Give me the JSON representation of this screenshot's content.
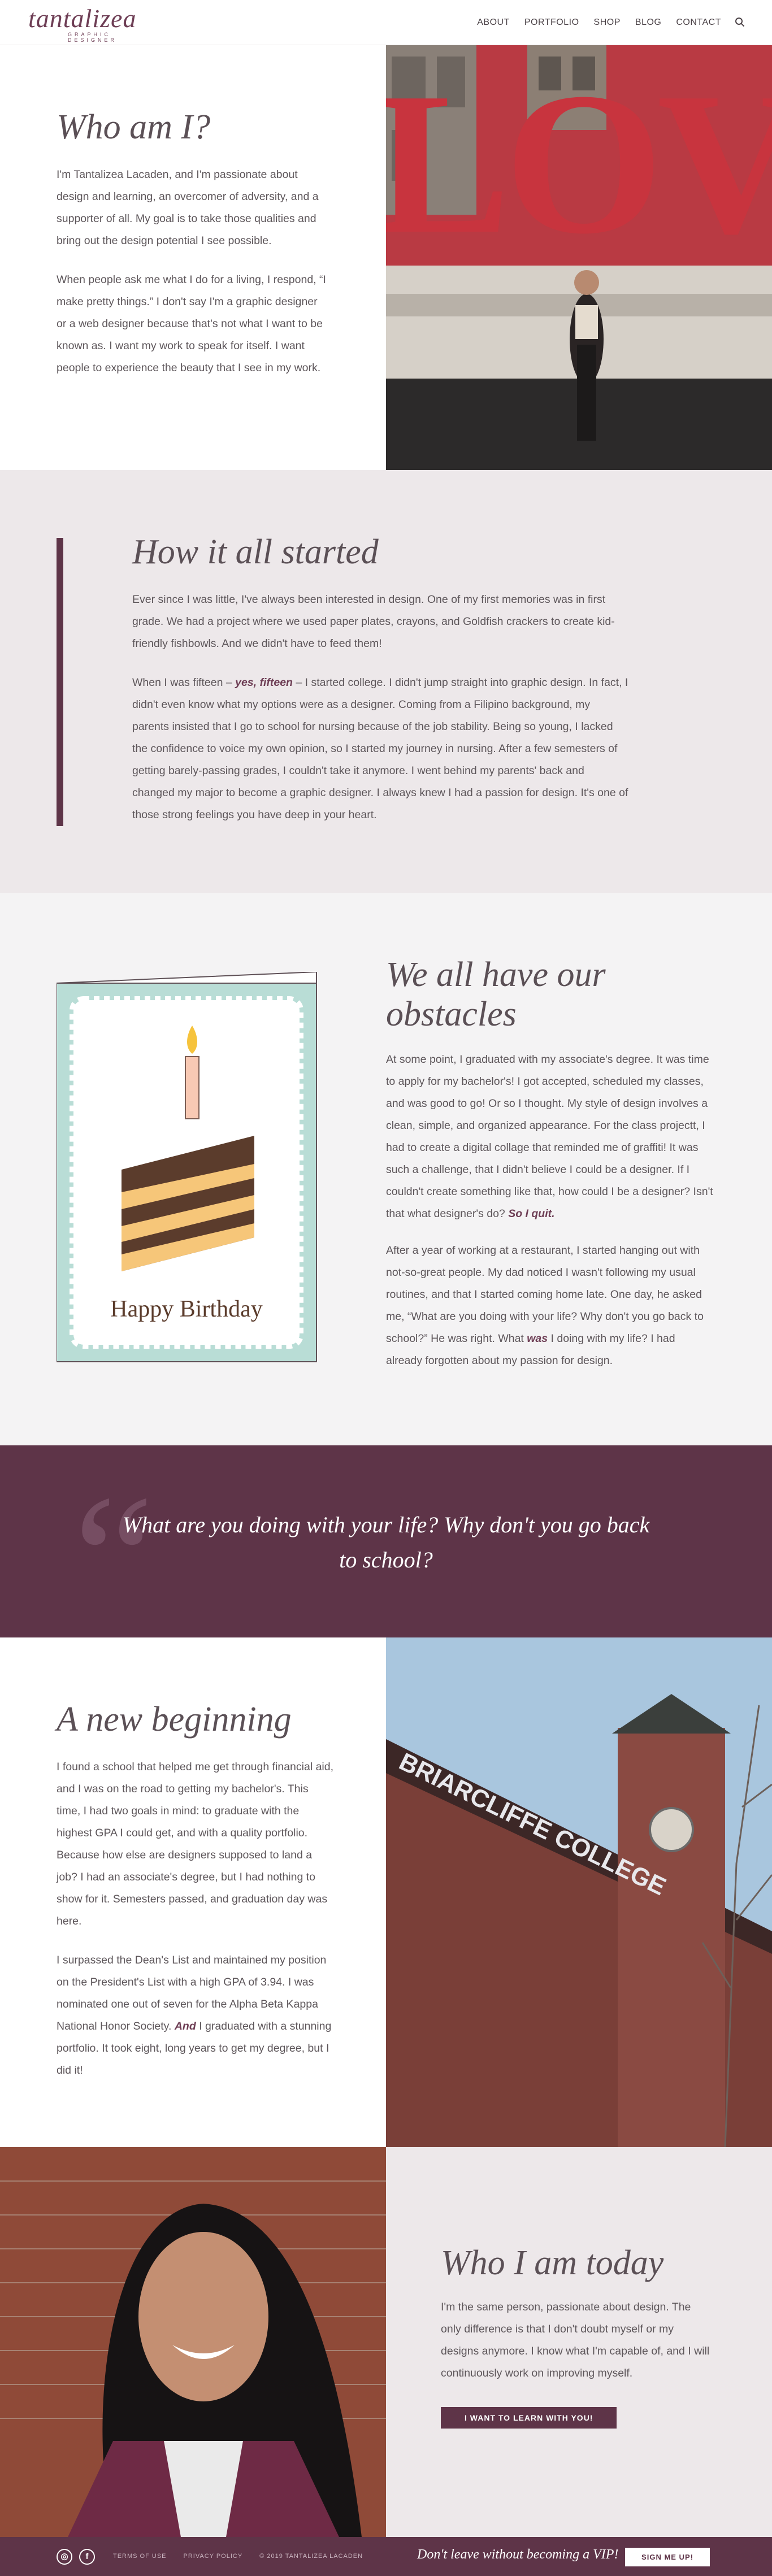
{
  "header": {
    "logo_main": "tantalizea",
    "logo_sub": "GRAPHIC DESIGNER",
    "nav": [
      "ABOUT",
      "PORTFOLIO",
      "SHOP",
      "BLOG",
      "CONTACT"
    ]
  },
  "who": {
    "title": "Who am I?",
    "p1": "I'm Tantalizea Lacaden, and I'm passionate about design and learning, an overcomer of adversity, and a supporter of all. My goal is to take those qualities and bring out the design potential I see possible.",
    "p2": "When people ask me what I do for a living, I respond, “I make pretty things.” I don't say I'm a graphic designer or a web designer because that's not what I want to be known as. I want my work to speak for itself. I want people to experience the beauty that I see in my work.",
    "photo_text": "LOVE"
  },
  "started": {
    "title": "How it all started",
    "p1": "Ever since I was little, I've always been interested in design. One of my first memories was in first grade. We had a project where we used paper plates, crayons, and Goldfish crackers to create kid-friendly fishbowls. And we didn't have to feed them!",
    "p2_a": "When I was fifteen – ",
    "p2_em": "yes, fifteen",
    "p2_b": " – I started college. I didn't jump straight into graphic design. In fact, I didn't even know what my options were as a designer. Coming from a Filipino background, my parents insisted that I go to school for nursing because of the job stability. Being so young, I lacked the confidence to voice my own opinion, so I started my journey in nursing. After a few semesters of getting barely-passing grades, I couldn't take it anymore. I went behind my parents' back and changed my major to become a graphic designer. I always knew I had a passion for design. It's one of those strong feelings you have deep in your heart."
  },
  "obstacles": {
    "title": "We all have our obstacles",
    "card_text": "Happy Birthday",
    "p1_a": "At some point, I graduated with my associate's degree. It was time to apply for my bachelor's! I got accepted, scheduled my classes, and was good to go! Or so I thought. My style of design involves a clean, simple, and organized appearance. For the class projectt, I had to create a digital collage that reminded me of graffiti! It was such a challenge, that I didn't believe I could be a designer. If I couldn't create something like that, how could I be a designer? Isn't that what designer's do? ",
    "p1_em": "So I quit.",
    "p2_a": "After a year of working at a restaurant, I started hanging out with not-so-great people. My dad noticed I wasn't following my usual routines, and that I started coming home late. One day, he asked me, “What are you doing with your life? Why don't you go back to school?” He was right. What ",
    "p2_em": "was",
    "p2_b": " I doing with my life? I had already forgotten about my passion for design."
  },
  "quote": {
    "mark": "“",
    "text": "What are you doing with your life? Why don't you go back to school?"
  },
  "beginning": {
    "title": "A new beginning",
    "p1": "I found a school that helped me get through financial aid, and I was on the road to getting my bachelor's. This time, I had two goals in mind: to graduate with the highest GPA I could get, and with a quality portfolio. Because how else are designers supposed to land a job? I had an associate's degree, but I had nothing to show for it. Semesters passed, and graduation day was here.",
    "p2_a": "I surpassed the Dean's List and maintained my position on the President's List with a high GPA of 3.94. I was nominated one out of seven for the Alpha Beta Kappa National Honor Society. ",
    "p2_em": "And",
    "p2_b": " I graduated with a stunning portfolio. It took eight, long years to get my degree, but I did it!",
    "sign": "BRIARCLIFFE COLLEGE"
  },
  "today": {
    "title": "Who I am today",
    "p1": "I'm the same person, passionate about design. The only difference is that I don't doubt myself or my designs anymore. I know what I'm capable of, and I will continuously work on improving myself.",
    "cta": "I WANT TO LEARN WITH YOU!"
  },
  "footer": {
    "links": [
      "TERMS OF USE",
      "PRIVACY POLICY",
      "© 2019 TANTALIZEA LACADEN"
    ],
    "vip": "Don't leave without becoming a VIP!",
    "signup": "SIGN ME UP!"
  },
  "colors": {
    "plum": "#5e3448",
    "accent": "#6e3e55",
    "grey_bg": "#ede8ea"
  }
}
